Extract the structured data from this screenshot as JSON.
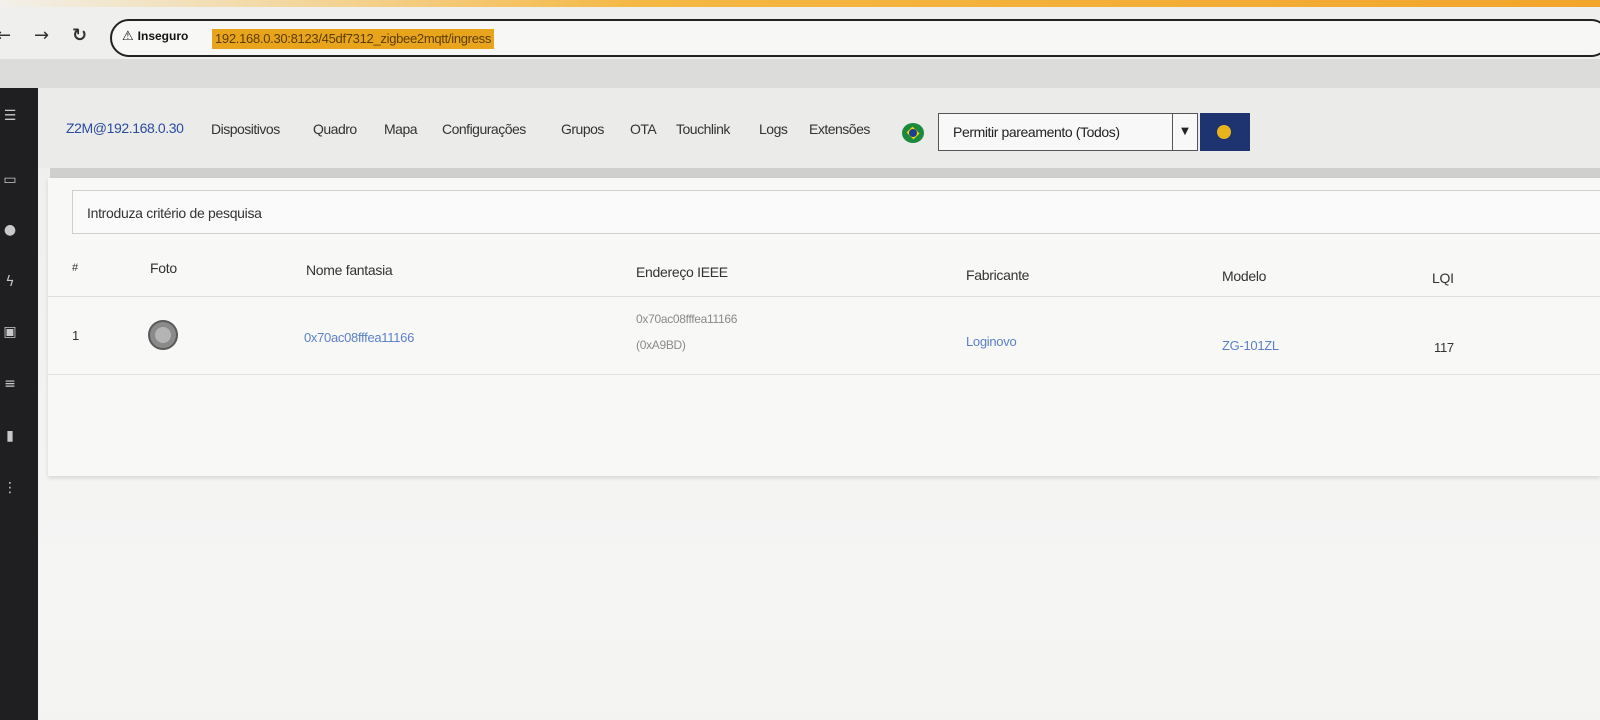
{
  "browser": {
    "back_icon": "back-arrow-icon",
    "forward_icon": "forward-arrow-icon",
    "reload_icon": "reload-icon",
    "insecure_label": "Inseguro",
    "url": "192.168.0.30:8123/45df7312_zigbee2mqtt/ingress"
  },
  "navbar": {
    "brand": "Z2M@192.168.0.30",
    "items": [
      "Dispositivos",
      "Quadro",
      "Mapa",
      "Configurações",
      "Grupos",
      "OTA",
      "Touchlink",
      "Logs",
      "Extensões"
    ],
    "language_icon": "brazil-flag-icon",
    "permit_join_label": "Permitir pareamento (Todos)",
    "permit_join_dropdown_icon": "chevron-down-icon",
    "theme_icon": "theme-toggle-icon"
  },
  "search": {
    "placeholder": "Introduza critério de pesquisa"
  },
  "table": {
    "headers": [
      "#",
      "Foto",
      "Nome fantasia",
      "Endereço IEEE",
      "Fabricante",
      "Modelo",
      "LQI"
    ],
    "rows": [
      {
        "index": "1",
        "friendly_name": "0x70ac08fffea11166",
        "ieee_address": "0x70ac08fffea11166",
        "network_address": "(0xA9BD)",
        "manufacturer": "Loginovo",
        "model": "ZG-101ZL",
        "lqi": "117"
      }
    ]
  },
  "colors": {
    "brand_link": "#2b4ba0",
    "table_link": "#5d80c9",
    "url_highlight": "#e8a51b",
    "dark_button": "#1d3470"
  }
}
